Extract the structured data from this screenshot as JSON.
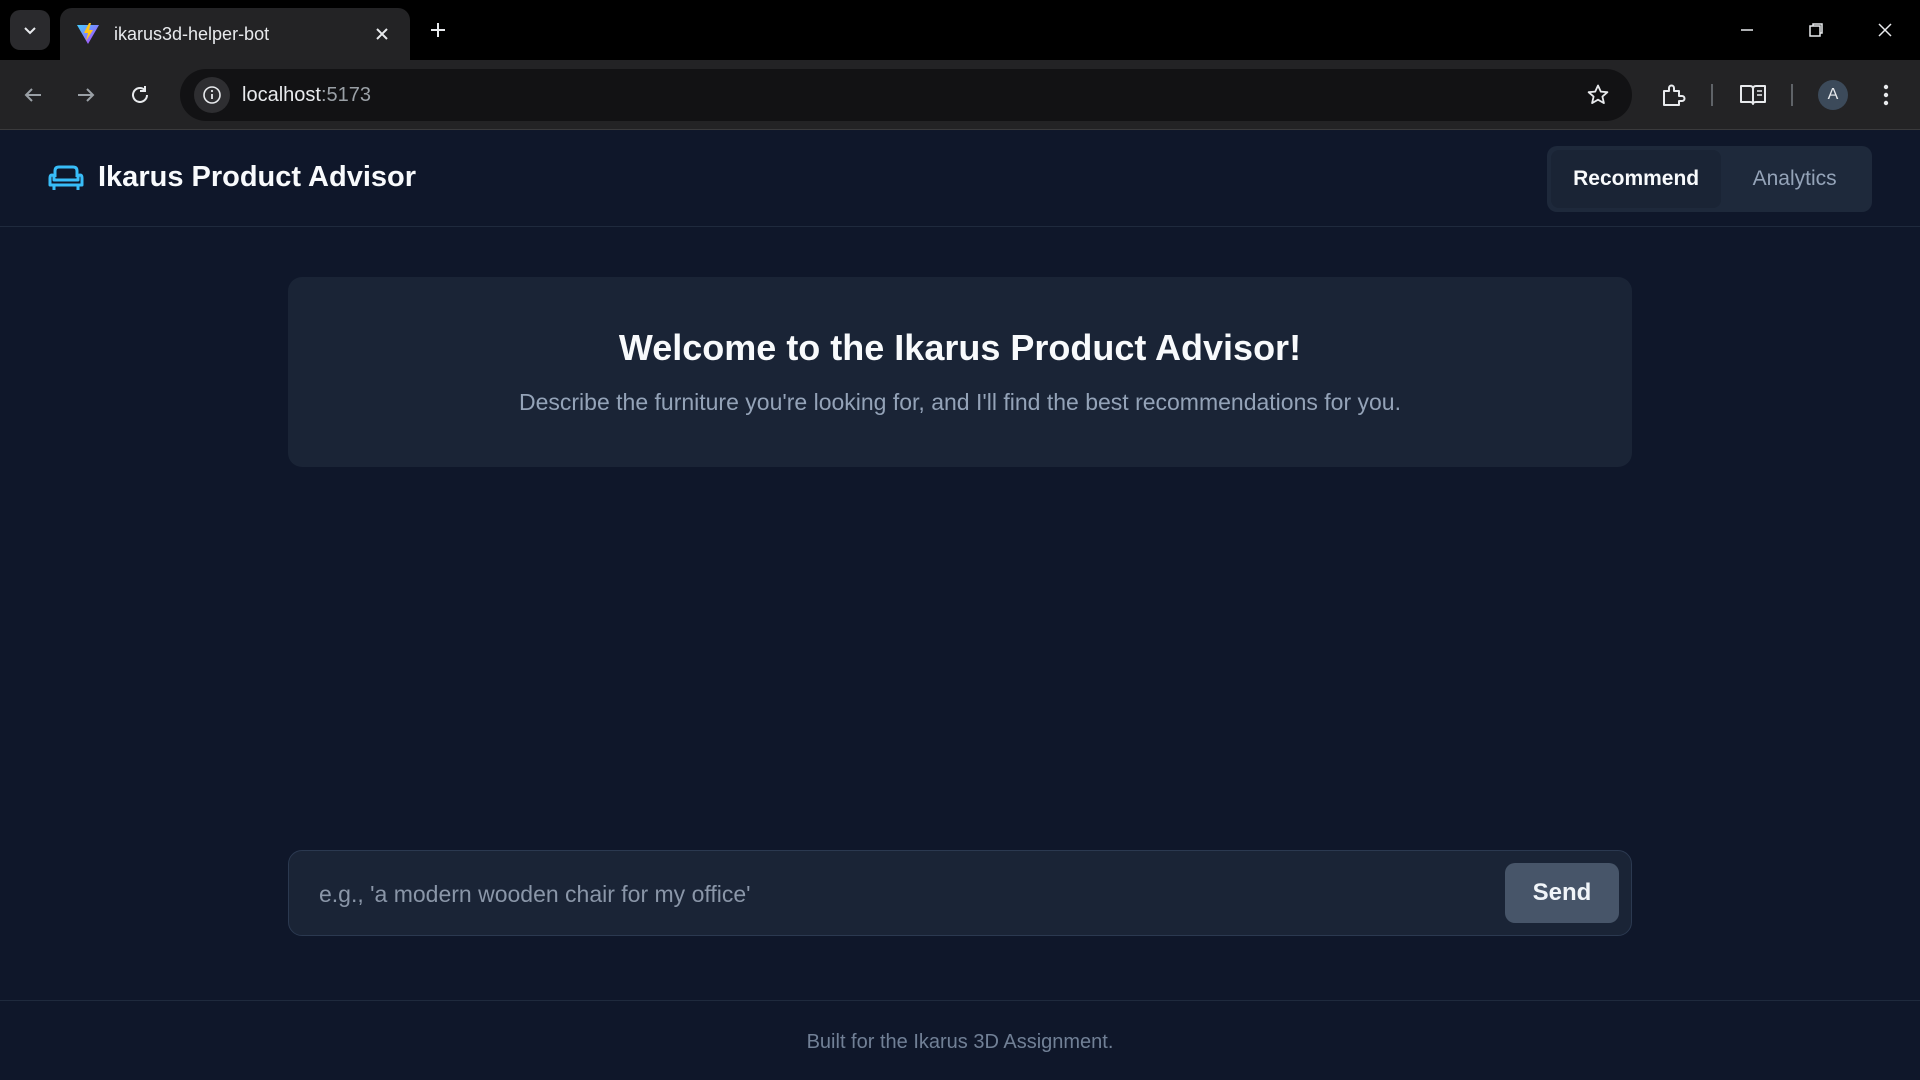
{
  "browser": {
    "tab_title": "ikarus3d-helper-bot",
    "url_host": "localhost",
    "url_port": ":5173",
    "profile_initial": "A"
  },
  "app": {
    "title": "Ikarus Product Advisor",
    "nav": [
      {
        "label": "Recommend",
        "active": true
      },
      {
        "label": "Analytics",
        "active": false
      }
    ]
  },
  "welcome": {
    "title": "Welcome to the Ikarus Product Advisor!",
    "subtitle": "Describe the furniture you're looking for, and I'll find the best recommendations for you."
  },
  "chat": {
    "placeholder": "e.g., 'a modern wooden chair for my office'",
    "value": "",
    "send_label": "Send"
  },
  "footer": {
    "text": "Built for the Ikarus 3D Assignment."
  },
  "icons": {
    "brand": "sofa-icon",
    "accent": "#38bdf8"
  }
}
